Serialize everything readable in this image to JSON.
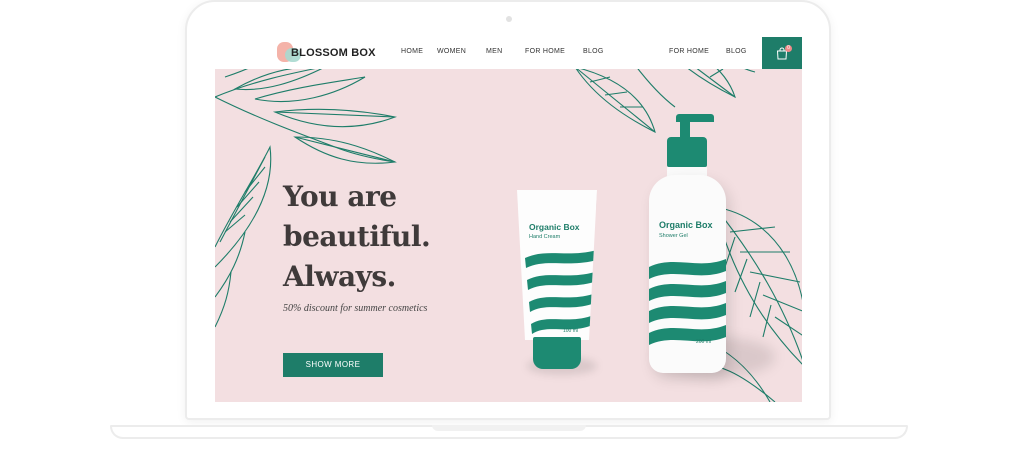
{
  "brand": {
    "name": "BLOSSOM BOX"
  },
  "nav": {
    "items": [
      "HOME",
      "WOMEN",
      "MEN",
      "FOR HOME",
      "BLOG"
    ],
    "right_items": [
      "FOR HOME",
      "BLOG"
    ],
    "cart": {
      "icon": "shopping-bag-icon",
      "badge": "0"
    }
  },
  "hero": {
    "title_lines": [
      "You are",
      "beautiful.",
      "Always."
    ],
    "subtitle": "50% discount for summer cosmetics",
    "cta_label": "SHOW MORE"
  },
  "products": {
    "tube": {
      "brand": "Organic Box",
      "product": "Hand Cream",
      "volume": "100 ml"
    },
    "bottle": {
      "brand": "Organic Box",
      "product": "Shower Gel",
      "volume": "200 ml"
    }
  },
  "colors": {
    "accent": "#1e7d69",
    "hero_background": "#f3dfe1",
    "badge": "#f08a8a",
    "title_text": "#3f3a3a"
  }
}
